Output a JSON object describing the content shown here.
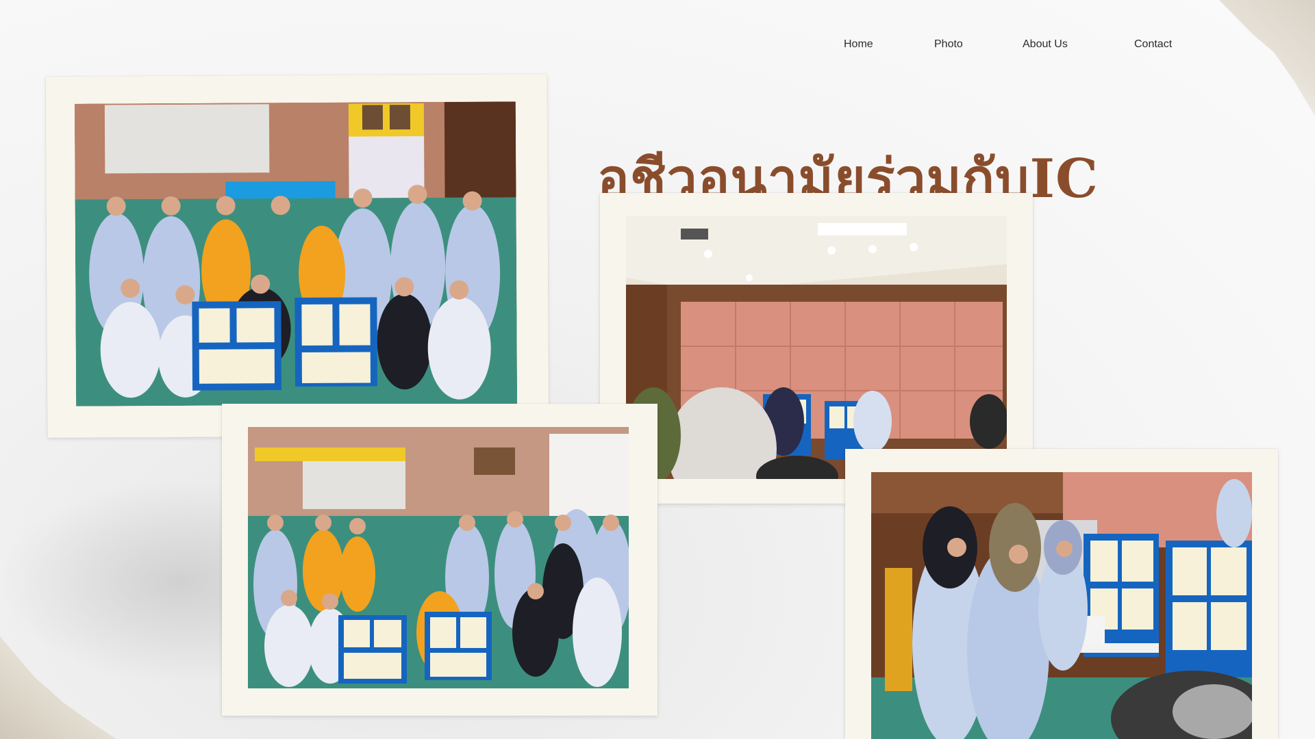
{
  "nav": {
    "items": [
      {
        "label": "Home"
      },
      {
        "label": "Photo"
      },
      {
        "label": "About Us"
      },
      {
        "label": "Contact"
      }
    ]
  },
  "page": {
    "title": "อชีวอนามัยร่วมกับIC"
  },
  "colors": {
    "title": "#8a4d2c",
    "frame": "#f8f5ec",
    "background": "#f4f4f4",
    "board_blue": "#1565c0",
    "uniform_blue": "#b7c9e6",
    "wall_salmon": "#d9907e",
    "wood": "#6b3e24"
  }
}
